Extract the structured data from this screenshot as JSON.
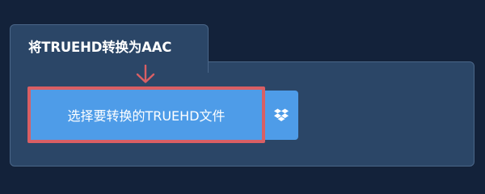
{
  "tab": {
    "title": "将TRUEHD转换为AAC"
  },
  "upload": {
    "button_label": "选择要转换的TRUEHD文件",
    "dropbox_icon": "dropbox-icon"
  },
  "colors": {
    "page_background": "#13223a",
    "panel_background": "#2b4667",
    "button": "#4e9ce8",
    "highlight": "#d95f64"
  }
}
